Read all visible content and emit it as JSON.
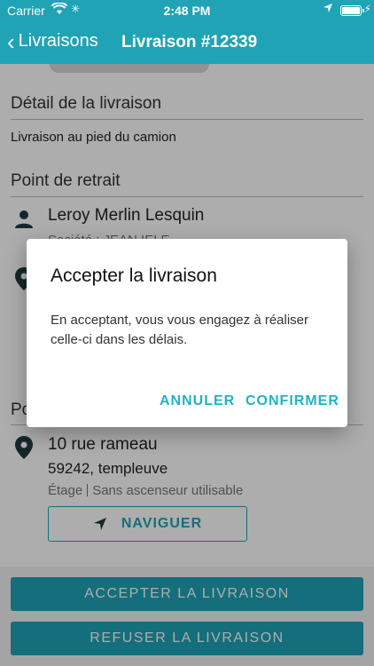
{
  "status_bar": {
    "carrier": "Carrier",
    "time": "2:48 PM"
  },
  "nav": {
    "back_label": "Livraisons",
    "title": "Livraison #12339"
  },
  "detail": {
    "section_title": "Détail de la livraison",
    "text": "Livraison au pied du camion"
  },
  "pickup": {
    "section_title": "Point de retrait",
    "name": "Leroy Merlin Lesquin",
    "company": "Société : JEAN IELE"
  },
  "dropoff": {
    "section_title_partial": "Po",
    "street": "10 rue rameau",
    "city": "59242, templeuve",
    "floor_label": "Étage",
    "elevator": "Sans ascenseur utilisable",
    "navigate_label": "NAVIGUER"
  },
  "actions": {
    "accept_label": "ACCEPTER LA LIVRAISON",
    "refuse_label": "REFUSER LA LIVRAISON"
  },
  "dialog": {
    "title": "Accepter la livraison",
    "body": "En acceptant, vous vous engagez à réaliser celle-ci dans les délais.",
    "cancel_label": "ANNULER",
    "confirm_label": "CONFIRMER"
  },
  "colors": {
    "primary": "#1fa3b5",
    "dialog_button": "#1fb3c5",
    "icon": "#1f3a3f"
  },
  "icons": [
    "back-chevron-icon",
    "wifi-icon",
    "location-arrow-icon",
    "battery-icon",
    "person-icon",
    "map-pin-icon",
    "navigation-arrow-icon"
  ]
}
